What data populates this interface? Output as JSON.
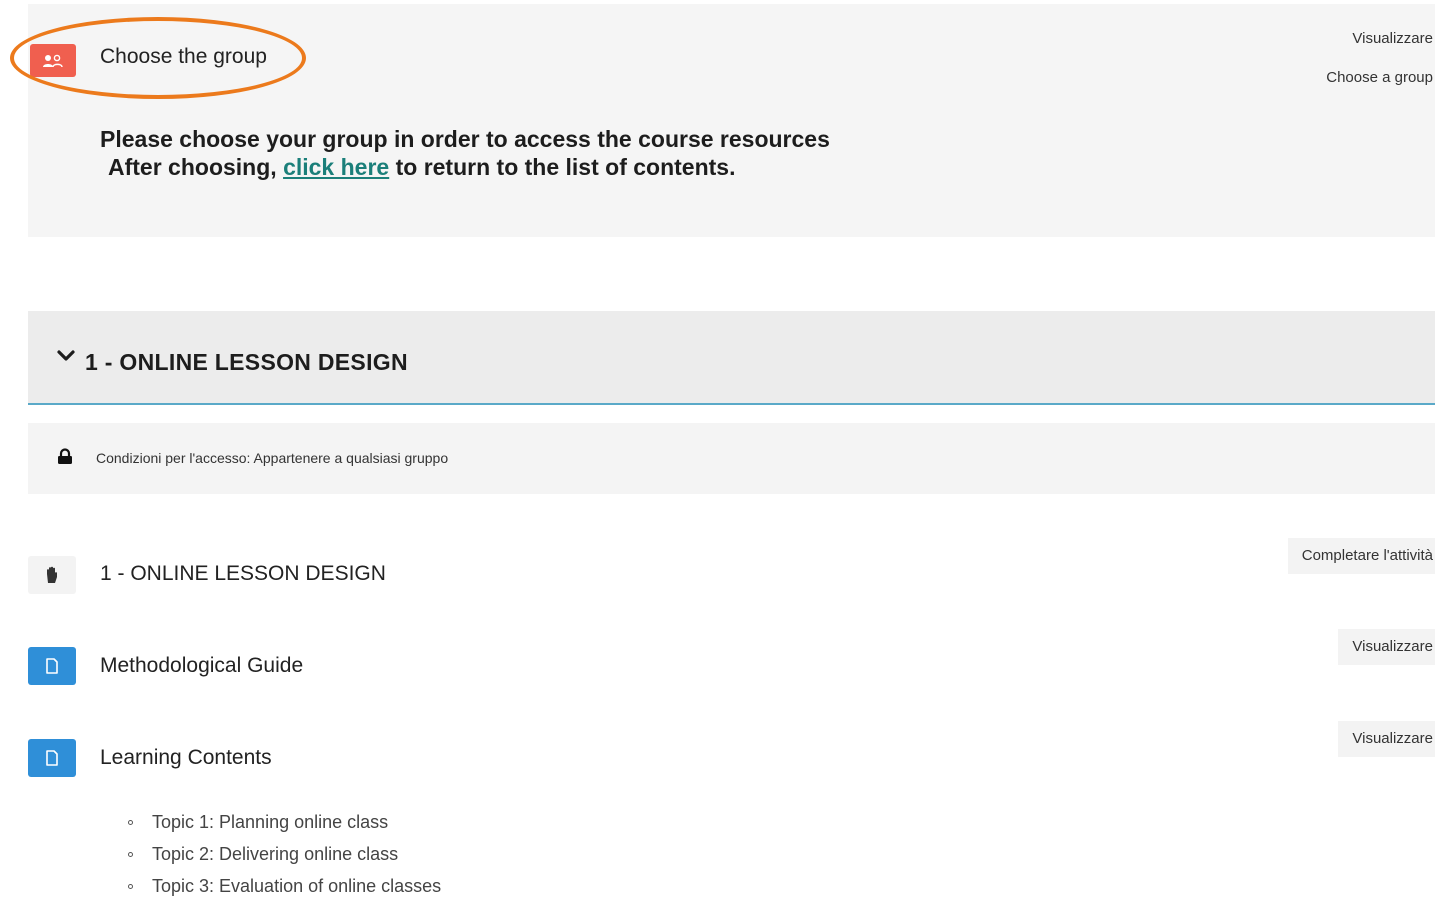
{
  "group_section": {
    "title": "Choose the group",
    "view_chip": "Visualizzare",
    "choose_chip": "Choose a group",
    "notice_line1": "Please choose your group in order to access the course resources",
    "notice_line2_before": "After choosing,",
    "notice_link": "click here",
    "notice_line2_after": "to return to the list of contents."
  },
  "section": {
    "title": "1 - ONLINE LESSON DESIGN",
    "restriction": "Condizioni per l'accesso: Appartenere a qualsiasi gruppo"
  },
  "activities": [
    {
      "name": "1 - ONLINE LESSON DESIGN",
      "chip": "Completare l'attività",
      "icon": "hand-icon"
    },
    {
      "name": "Methodological Guide",
      "chip": "Visualizzare",
      "icon": "file-icon"
    },
    {
      "name": "Learning Contents",
      "chip": "Visualizzare",
      "icon": "file-icon"
    }
  ],
  "topics": [
    "Topic 1: Planning online class",
    "Topic 2: Delivering online class",
    "Topic 3: Evaluation of online classes"
  ],
  "colors": {
    "group_icon_bg": "#f05f4f",
    "file_icon_bg": "#2f8fd8",
    "highlight": "#ec7a1c",
    "link": "#1b7f7a"
  }
}
